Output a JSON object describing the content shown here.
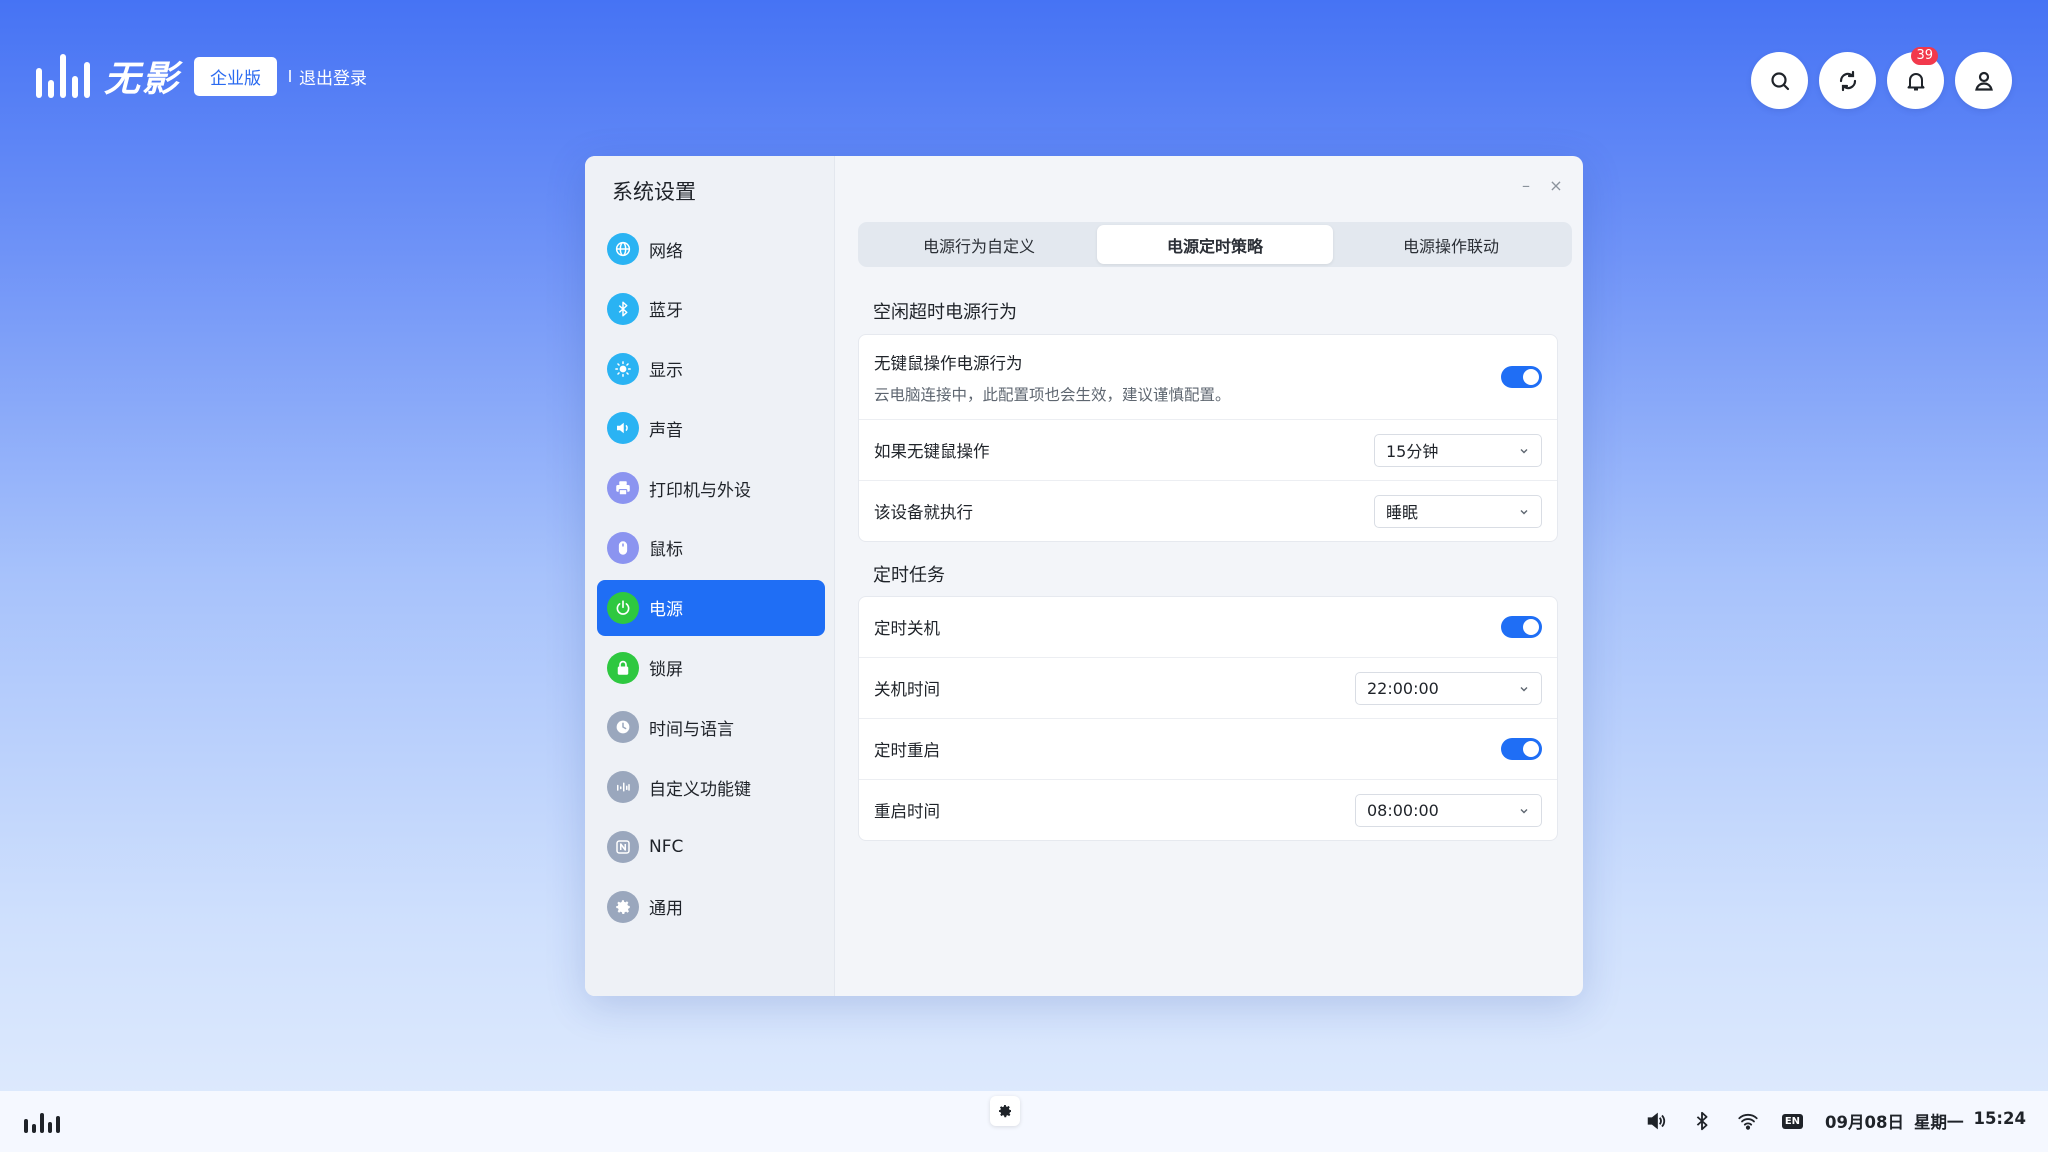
{
  "brand": {
    "name": "无影",
    "edition": "企业版",
    "logout": "退出登录"
  },
  "top_actions": {
    "notification_count": "39"
  },
  "window": {
    "title": "系统设置",
    "controls": {
      "minimize": "–",
      "close": "×"
    }
  },
  "sidebar": {
    "items": [
      {
        "label": "网络",
        "icon": "globe-icon",
        "color": "#2ab3f3"
      },
      {
        "label": "蓝牙",
        "icon": "bluetooth-icon",
        "color": "#2ab3f3"
      },
      {
        "label": "显示",
        "icon": "sun-icon",
        "color": "#2ab3f3"
      },
      {
        "label": "声音",
        "icon": "speaker-icon",
        "color": "#2ab3f3"
      },
      {
        "label": "打印机与外设",
        "icon": "printer-icon",
        "color": "#8b94f0"
      },
      {
        "label": "鼠标",
        "icon": "mouse-icon",
        "color": "#8b94f0"
      },
      {
        "label": "电源",
        "icon": "power-icon",
        "color": "#2ec840",
        "active": true
      },
      {
        "label": "锁屏",
        "icon": "lock-icon",
        "color": "#2ec840"
      },
      {
        "label": "时间与语言",
        "icon": "clock-icon",
        "color": "#9aa7bd"
      },
      {
        "label": "自定义功能键",
        "icon": "keys-icon",
        "color": "#9aa7bd"
      },
      {
        "label": "NFC",
        "icon": "nfc-icon",
        "color": "#9aa7bd"
      },
      {
        "label": "通用",
        "icon": "gear-icon",
        "color": "#9aa7bd"
      }
    ]
  },
  "tabs": [
    {
      "label": "电源行为自定义",
      "active": false
    },
    {
      "label": "电源定时策略",
      "active": true
    },
    {
      "label": "电源操作联动",
      "active": false
    }
  ],
  "idle_section": {
    "title": "空闲超时电源行为",
    "no_input_toggle": {
      "label": "无键鼠操作电源行为",
      "desc": "云电脑连接中，此配置项也会生效，建议谨慎配置。",
      "on": true
    },
    "idle_time": {
      "label": "如果无键鼠操作",
      "value": "15分钟"
    },
    "idle_action": {
      "label": "该设备就执行",
      "value": "睡眠"
    }
  },
  "scheduled_section": {
    "title": "定时任务",
    "shutdown_toggle": {
      "label": "定时关机",
      "on": true
    },
    "shutdown_time": {
      "label": "关机时间",
      "value": "22:00:00"
    },
    "restart_toggle": {
      "label": "定时重启",
      "on": true
    },
    "restart_time": {
      "label": "重启时间",
      "value": "08:00:00"
    }
  },
  "taskbar": {
    "lang": "EN",
    "date": "09月08日",
    "weekday": "星期一",
    "time": "15:24"
  },
  "colors": {
    "accent": "#1f6ef5",
    "badge": "#f2394c"
  }
}
